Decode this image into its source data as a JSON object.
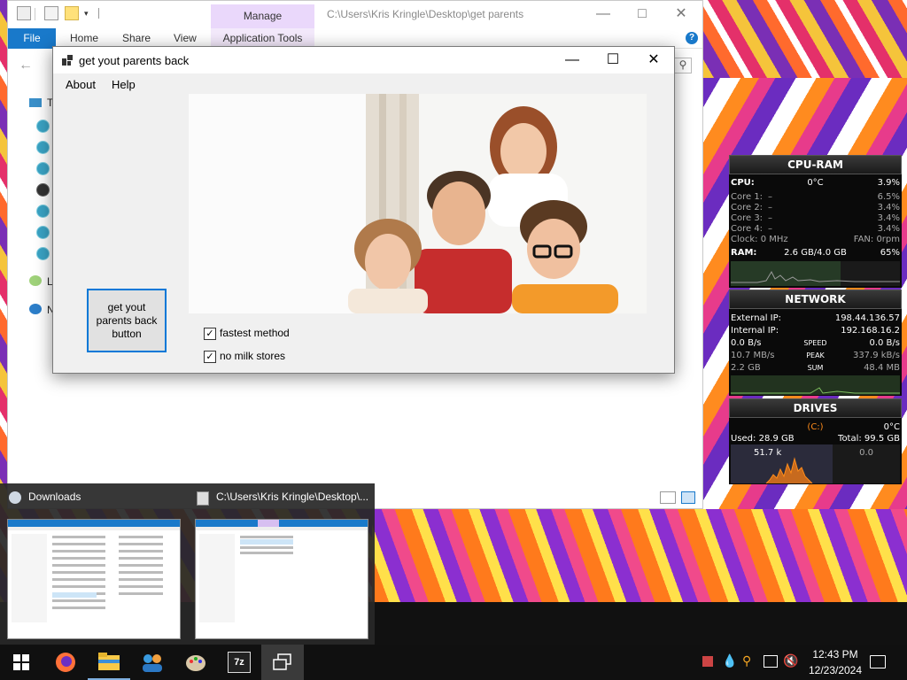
{
  "explorer": {
    "manage_tab": "Manage",
    "path": "C:\\Users\\Kris Kringle\\Desktop\\get parents",
    "ribbon": {
      "file": "File",
      "home": "Home",
      "share": "Share",
      "view": "View",
      "app_tools": "Application Tools"
    }
  },
  "app": {
    "title": "get yout parents back",
    "menu": {
      "about": "About",
      "help": "Help"
    },
    "button_label": "get yout parents back button",
    "options": [
      {
        "label": "fastest method",
        "checked": true
      },
      {
        "label": "no milk stores",
        "checked": true
      }
    ]
  },
  "gadgets": {
    "cpu": {
      "title": "CPU-RAM",
      "cpu_label": "CPU:",
      "cpu_temp": "0°C",
      "cpu_pct": "3.9%",
      "cores": [
        {
          "label": "Core 1:",
          "dash": "–",
          "value": "6.5%"
        },
        {
          "label": "Core 2:",
          "dash": "–",
          "value": "3.4%"
        },
        {
          "label": "Core 3:",
          "dash": "–",
          "value": "3.4%"
        },
        {
          "label": "Core 4:",
          "dash": "–",
          "value": "3.4%"
        }
      ],
      "clock": "Clock: 0 MHz",
      "fan": "FAN: 0rpm",
      "ram_label": "RAM:",
      "ram_value": "2.6 GB/4.0 GB",
      "ram_pct": "65%"
    },
    "network": {
      "title": "NETWORK",
      "ext_label": "External IP:",
      "ext_ip": "198.44.136.57",
      "int_label": "Internal IP:",
      "int_ip": "192.168.16.2",
      "speed_left": "0.0 B/s",
      "speed_label": "SPEED",
      "speed_right": "0.0 B/s",
      "peak_left": "10.7 MB/s",
      "peak_label": "PEAK",
      "peak_right": "337.9 kB/s",
      "sum_left": "2.2 GB",
      "sum_label": "SUM",
      "sum_right": "48.4 MB"
    },
    "drives": {
      "title": "DRIVES",
      "drive": "(C:)",
      "temp": "0°C",
      "used": "Used: 28.9 GB",
      "total": "Total: 99.5 GB",
      "read": "51.7 k",
      "write": "0.0"
    }
  },
  "thumbnails": [
    {
      "title": "Downloads"
    },
    {
      "title": "C:\\Users\\Kris Kringle\\Desktop\\..."
    }
  ],
  "taskbar": {
    "time": "12:43 PM",
    "date": "12/23/2024"
  },
  "colors": {
    "accent": "#0078d7",
    "file_tab": "#1979ca",
    "manage_tab": "#ead8fb"
  }
}
